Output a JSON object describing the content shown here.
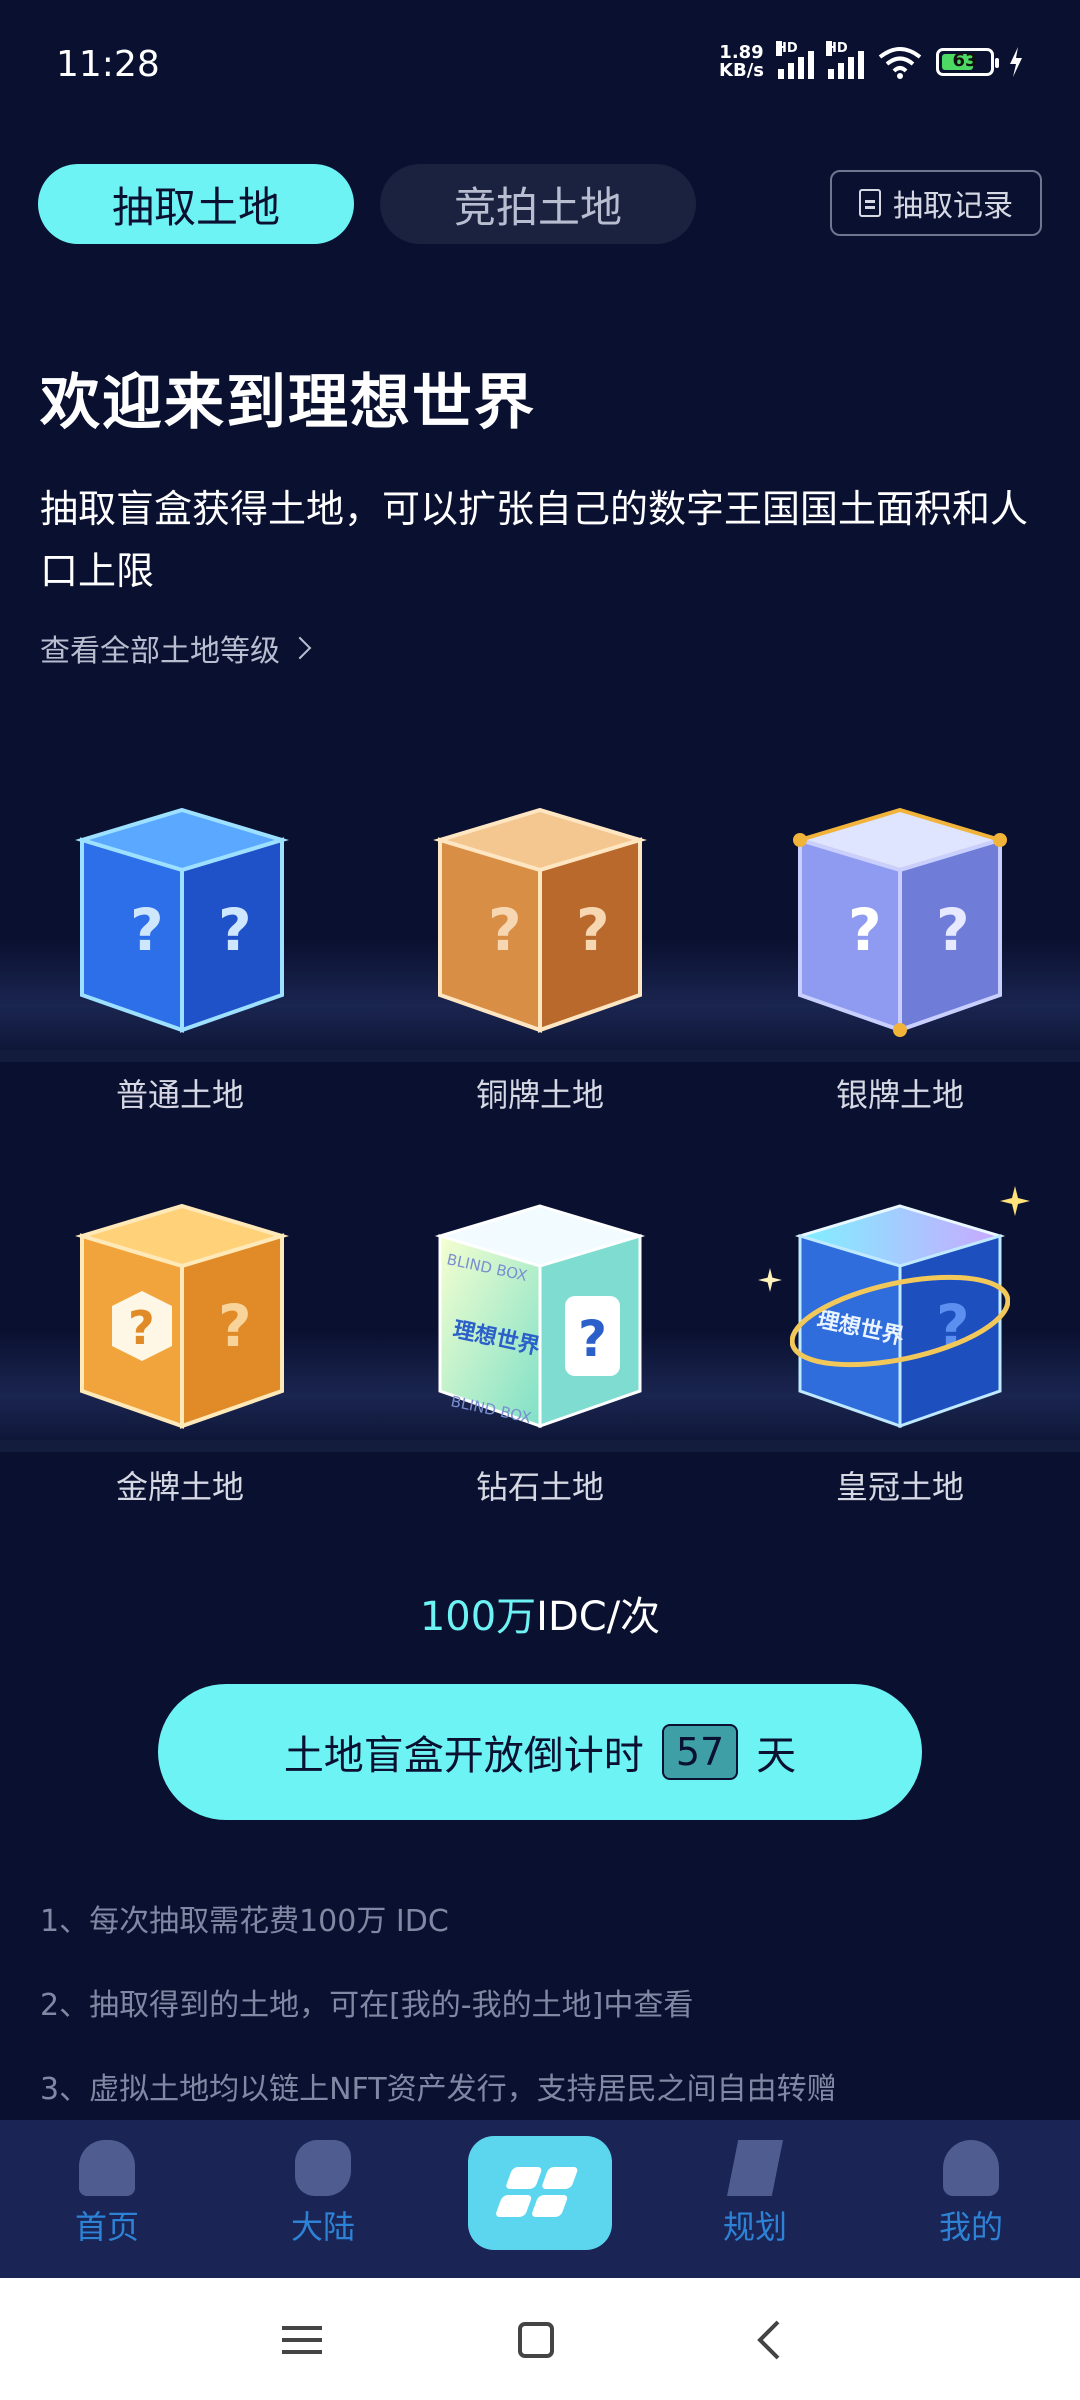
{
  "status": {
    "time": "11:28",
    "net_speed_top": "1.89",
    "net_speed_bottom": "KB/s",
    "hd1": "HD",
    "hd2": "HD",
    "battery": "63"
  },
  "tabs": {
    "draw": "抽取土地",
    "auction": "竞拍土地",
    "record": "抽取记录"
  },
  "hero": {
    "title": "欢迎来到理想世界",
    "description": "抽取盲盒获得土地，可以扩张自己的数字王国国土面积和人口上限",
    "view_all": "查看全部土地等级"
  },
  "lands": [
    {
      "label": "普通土地",
      "icon": "blue-mystery-box"
    },
    {
      "label": "铜牌土地",
      "icon": "bronze-mystery-box"
    },
    {
      "label": "银牌土地",
      "icon": "silver-mystery-box"
    },
    {
      "label": "金牌土地",
      "icon": "gold-mystery-box"
    },
    {
      "label": "钻石土地",
      "icon": "diamond-blind-box"
    },
    {
      "label": "皇冠土地",
      "icon": "crown-mystery-box"
    }
  ],
  "box_text": {
    "blind_box": "BLIND BOX",
    "logo": "理想世界"
  },
  "price": {
    "amount": "100万",
    "unit": "IDC/次"
  },
  "cta": {
    "prefix": "土地盲盒开放倒计时",
    "count": "57",
    "suffix": "天"
  },
  "rules": [
    "1、每次抽取需花费100万 IDC",
    "2、抽取得到的土地，可在[我的-我的土地]中查看",
    "3、虚拟土地均以链上NFT资产发行，支持居民之间自由转赠"
  ],
  "nav": {
    "home": "首页",
    "continent": "大陆",
    "plan": "规划",
    "mine": "我的"
  },
  "colors": {
    "background": "#0a1030",
    "accent": "#6ef3f5",
    "nav_bg": "#1a2555",
    "nav_text": "#2d82d6"
  }
}
